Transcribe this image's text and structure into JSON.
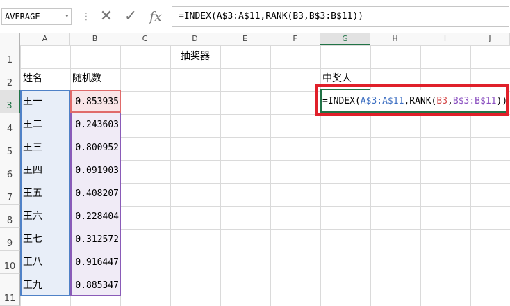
{
  "namebox": {
    "value": "AVERAGE",
    "dropdown": "▾"
  },
  "formula_bar": {
    "separator": "⋮",
    "cancel": "✕",
    "enter": "✓",
    "fx": "fx",
    "formula": "=INDEX(A$3:A$11,RANK(B3,B$3:B$11))"
  },
  "columns": [
    "A",
    "B",
    "C",
    "D",
    "E",
    "F",
    "G",
    "H",
    "I",
    "J"
  ],
  "rows": [
    "1",
    "2",
    "3",
    "4",
    "5",
    "6",
    "7",
    "8",
    "9",
    "10",
    "11"
  ],
  "cells": {
    "D1": "抽奖器",
    "A2": "姓名",
    "B2": "随机数",
    "G2": "中奖人"
  },
  "names": [
    "王一",
    "王二",
    "王三",
    "王四",
    "王五",
    "王六",
    "王七",
    "王八",
    "王九"
  ],
  "randoms": [
    "0.853935",
    "0.243603",
    "0.800952",
    "0.091903",
    "0.408207",
    "0.228404",
    "0.312572",
    "0.916447",
    "0.885347"
  ],
  "edit_formula": {
    "p1": "=INDEX(",
    "ref_a": "A$3:A$11",
    "p2": ",RANK(",
    "ref_b3": "B3",
    "p3": ",",
    "ref_b": "B$3:B$11",
    "p4": "))"
  },
  "colors": {
    "ref_a": "#3d6fc2",
    "ref_b3": "#d44a4a",
    "ref_b": "#8a4fc0",
    "highlight": "#e0202a",
    "active": "#217346"
  }
}
